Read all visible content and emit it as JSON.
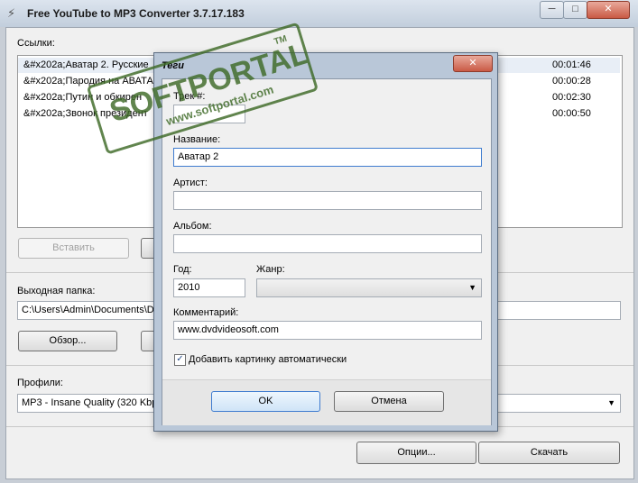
{
  "window": {
    "title": "Free YouTube to MP3 Converter 3.7.17.183",
    "minimize": "─",
    "maximize": "□",
    "close": "✕"
  },
  "links": {
    "label": "Ссылки:",
    "rows": [
      {
        "title": "&#x202a;Аватар 2. Русские",
        "duration": "00:01:46"
      },
      {
        "title": "&#x202a;Пародия на АВАТА",
        "duration": "00:00:28"
      },
      {
        "title": "&#x202a;Путин и обкирен",
        "duration": "00:02:30"
      },
      {
        "title": "&#x202a;Звонок президент",
        "duration": "00:00:50"
      }
    ],
    "paste_button": "Вставить"
  },
  "output": {
    "label": "Выходная папка:",
    "path": "C:\\Users\\Admin\\Documents\\DV",
    "browse_button": "Обзор..."
  },
  "profiles": {
    "label": "Профили:",
    "selected": "MP3 - Insane Quality (320 Kbps"
  },
  "footer": {
    "options_button": "Опции...",
    "download_button": "Скачать"
  },
  "dialog": {
    "title": "Теги",
    "close": "✕",
    "track_label": "Трек #:",
    "track_value": "",
    "name_label": "Название:",
    "name_value": "Аватар 2",
    "artist_label": "Артист:",
    "artist_value": "",
    "album_label": "Альбом:",
    "album_value": "",
    "year_label": "Год:",
    "year_value": "2010",
    "genre_label": "Жанр:",
    "genre_value": "",
    "comment_label": "Комментарий:",
    "comment_value": "www.dvdvideosoft.com",
    "auto_cover_label": "Добавить картинку автоматически",
    "auto_cover_checked": true,
    "ok_button": "OK",
    "cancel_button": "Отмена"
  },
  "watermark": {
    "brand": "SOFTPORTAL",
    "tm": "TM",
    "url": "www.softportal.com"
  }
}
